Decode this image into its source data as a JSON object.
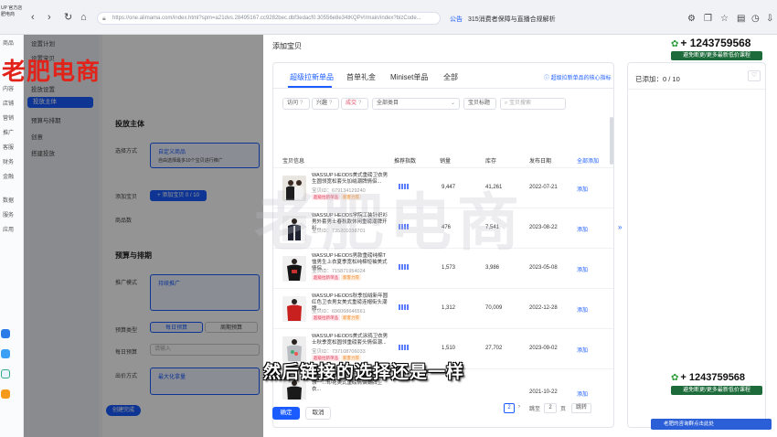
{
  "browser": {
    "logo": "UP 官方店 肥电商",
    "url": "https://one.alimama.com/index.html?spm=a21dvs.28495167.cc9282bec.dbf3edacf0.30556e8e34tKQP#!/main/index?bizCode...",
    "notice_label": "公告",
    "notice_text": "315消费者保障与直播合规解析"
  },
  "left_nav": [
    "商品",
    "内容",
    "店铺",
    "营销",
    "推广",
    "客服",
    "财务",
    "金融",
    "数据",
    "服务",
    "应用"
  ],
  "bg_menu": [
    "设置计划",
    "设置宝贝",
    "投放设置",
    "投放主体",
    "预算与排期",
    "创意",
    "搭建投放"
  ],
  "bg_content": {
    "section1": "投放主体",
    "label_select": "选择方式",
    "option1": "自定义商品",
    "option1_desc": "自由选择最多10个宝贝进行推广",
    "label_item": "添加宝贝",
    "add_btn": "+ 添加宝贝 0 / 10",
    "label_scene": "商品数",
    "section2": "预算与排期",
    "label_mode": "推广模式",
    "mode_option": "持续推广",
    "label_budget_type": "预算类型",
    "budget_daily": "每日预算",
    "budget_total": "周期预算",
    "label_daily": "每日预算",
    "daily_placeholder": "请输入",
    "label_bid": "出价方式",
    "bid_option": "最大化拿量",
    "create_btn": "创建完成"
  },
  "drawer": {
    "title": "添加宝贝",
    "tabs": [
      "超级拉新单品",
      "首单礼金",
      "Miniset单品",
      "全部"
    ],
    "help_link": "超级拉新单品的核心指标",
    "filters": {
      "chip1": "访问",
      "chip2": "兴趣",
      "chip3": "成交",
      "category": "全部类目",
      "sort": "宝贝标题",
      "search_placeholder": "宝贝搜索"
    },
    "columns": [
      "宝贝信息",
      "推荐指数",
      "销量",
      "库存",
      "发布日期",
      "全部添加"
    ],
    "tag_red": "超级拉新单品",
    "tag_orange": "新客力荐",
    "add_label": "添加",
    "rows": [
      {
        "name": "WASSUP HEODS美式重磅卫衣男生圆领宽松套头加绒潮牌情侣...",
        "id": "宝贝ID：679134129240",
        "sales": "9,447",
        "stock": "41,261",
        "date": "2022-07-21"
      },
      {
        "name": "WASSUP HEODS学院工装针织衫男外套男士春秋款休闲重磅潮牌开衫...",
        "id": "宝贝ID：735201038701",
        "sales": "476",
        "stock": "7,541",
        "date": "2023-08-22"
      },
      {
        "name": "WASSUP HEODS男款重磅纯棉T恤男生上衣夏季宽松纯棉短袖美式情侣...",
        "id": "宝贝ID：715871954024",
        "sales": "1,573",
        "stock": "3,986",
        "date": "2023-05-08"
      },
      {
        "name": "WASSUP HEODS秋季加绒新年圆红色卫衣男女美式重磅连帽街头潮牌...",
        "id": "宝贝ID：696068646561",
        "sales": "1,312",
        "stock": "70,009",
        "date": "2022-12-28"
      },
      {
        "name": "WASSUP HEODS美式涂鸦卫衣男士秋季宽松圆领重磅套头情侣潮...",
        "id": "宝贝ID：737108706033",
        "sales": "1,510",
        "stock": "27,702",
        "date": "2023-09-02"
      },
      {
        "name": "WASSUP HEODS卫衣男秋季 圆领一…印花美式重磅情侣潮牌卫衣...",
        "id": "",
        "sales": "",
        "stock": "",
        "date": "2021-10-22"
      }
    ],
    "pager": {
      "page": "2",
      "goto_label": "跳至",
      "goto_value": "2",
      "page_unit": "页",
      "jump": "跳转"
    },
    "selected_label": "已添加：0 / 10",
    "ok": "确定",
    "cancel": "取消"
  },
  "overlays": {
    "brand": "老肥电商",
    "center_watermark": "老肥电商",
    "promo_number": "+ 1243759568",
    "promo_badge": "避免断更/更多最新低价课程",
    "subtitle": "然后链接的选择还是一样",
    "chat": "老肥的咨询群点击此处"
  }
}
